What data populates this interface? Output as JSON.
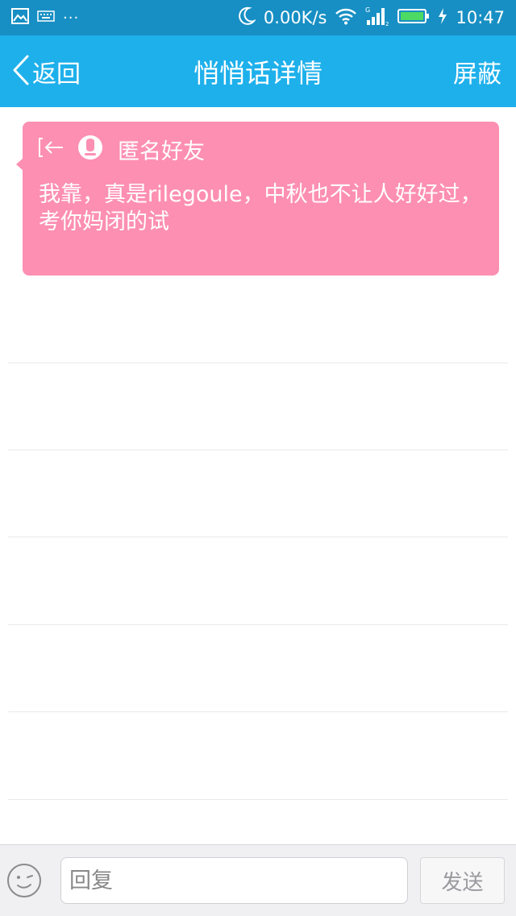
{
  "status_bar": {
    "network_speed": "0.00K/s",
    "time": "10:47",
    "more_indicator": "···",
    "icons": [
      "image-icon",
      "keyboard-icon",
      "moon-icon",
      "wifi-icon",
      "signal-icon",
      "battery-icon",
      "charging-icon"
    ]
  },
  "header": {
    "back_label": "返回",
    "title": "悄悄话详情",
    "block_label": "屏蔽"
  },
  "message": {
    "sender": "匿名好友",
    "text": "我靠，真是rilegoule，中秋也不让人好好过，考你妈闭的试"
  },
  "composer": {
    "placeholder": "回复",
    "send_label": "发送"
  },
  "colors": {
    "status_bar": "#178fc4",
    "title_bar": "#1eb0eb",
    "bubble": "#fd8fb3",
    "battery": "#4cd964"
  }
}
